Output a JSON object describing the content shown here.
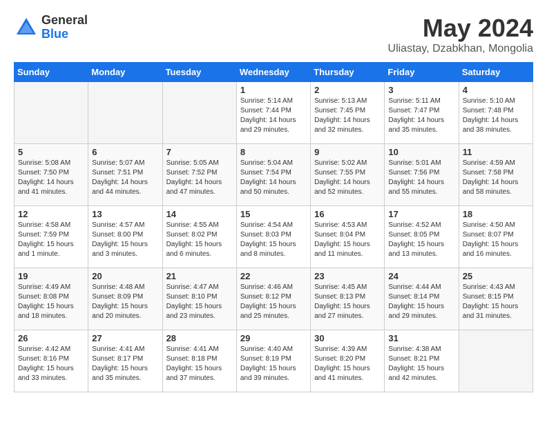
{
  "header": {
    "logo_line1": "General",
    "logo_line2": "Blue",
    "title": "May 2024",
    "subtitle": "Uliastay, Dzabkhan, Mongolia"
  },
  "weekdays": [
    "Sunday",
    "Monday",
    "Tuesday",
    "Wednesday",
    "Thursday",
    "Friday",
    "Saturday"
  ],
  "weeks": [
    [
      {
        "day": "",
        "empty": true
      },
      {
        "day": "",
        "empty": true
      },
      {
        "day": "",
        "empty": true
      },
      {
        "day": "1",
        "sunrise": "Sunrise: 5:14 AM",
        "sunset": "Sunset: 7:44 PM",
        "daylight": "Daylight: 14 hours and 29 minutes."
      },
      {
        "day": "2",
        "sunrise": "Sunrise: 5:13 AM",
        "sunset": "Sunset: 7:45 PM",
        "daylight": "Daylight: 14 hours and 32 minutes."
      },
      {
        "day": "3",
        "sunrise": "Sunrise: 5:11 AM",
        "sunset": "Sunset: 7:47 PM",
        "daylight": "Daylight: 14 hours and 35 minutes."
      },
      {
        "day": "4",
        "sunrise": "Sunrise: 5:10 AM",
        "sunset": "Sunset: 7:48 PM",
        "daylight": "Daylight: 14 hours and 38 minutes."
      }
    ],
    [
      {
        "day": "5",
        "sunrise": "Sunrise: 5:08 AM",
        "sunset": "Sunset: 7:50 PM",
        "daylight": "Daylight: 14 hours and 41 minutes."
      },
      {
        "day": "6",
        "sunrise": "Sunrise: 5:07 AM",
        "sunset": "Sunset: 7:51 PM",
        "daylight": "Daylight: 14 hours and 44 minutes."
      },
      {
        "day": "7",
        "sunrise": "Sunrise: 5:05 AM",
        "sunset": "Sunset: 7:52 PM",
        "daylight": "Daylight: 14 hours and 47 minutes."
      },
      {
        "day": "8",
        "sunrise": "Sunrise: 5:04 AM",
        "sunset": "Sunset: 7:54 PM",
        "daylight": "Daylight: 14 hours and 50 minutes."
      },
      {
        "day": "9",
        "sunrise": "Sunrise: 5:02 AM",
        "sunset": "Sunset: 7:55 PM",
        "daylight": "Daylight: 14 hours and 52 minutes."
      },
      {
        "day": "10",
        "sunrise": "Sunrise: 5:01 AM",
        "sunset": "Sunset: 7:56 PM",
        "daylight": "Daylight: 14 hours and 55 minutes."
      },
      {
        "day": "11",
        "sunrise": "Sunrise: 4:59 AM",
        "sunset": "Sunset: 7:58 PM",
        "daylight": "Daylight: 14 hours and 58 minutes."
      }
    ],
    [
      {
        "day": "12",
        "sunrise": "Sunrise: 4:58 AM",
        "sunset": "Sunset: 7:59 PM",
        "daylight": "Daylight: 15 hours and 1 minute."
      },
      {
        "day": "13",
        "sunrise": "Sunrise: 4:57 AM",
        "sunset": "Sunset: 8:00 PM",
        "daylight": "Daylight: 15 hours and 3 minutes."
      },
      {
        "day": "14",
        "sunrise": "Sunrise: 4:55 AM",
        "sunset": "Sunset: 8:02 PM",
        "daylight": "Daylight: 15 hours and 6 minutes."
      },
      {
        "day": "15",
        "sunrise": "Sunrise: 4:54 AM",
        "sunset": "Sunset: 8:03 PM",
        "daylight": "Daylight: 15 hours and 8 minutes."
      },
      {
        "day": "16",
        "sunrise": "Sunrise: 4:53 AM",
        "sunset": "Sunset: 8:04 PM",
        "daylight": "Daylight: 15 hours and 11 minutes."
      },
      {
        "day": "17",
        "sunrise": "Sunrise: 4:52 AM",
        "sunset": "Sunset: 8:05 PM",
        "daylight": "Daylight: 15 hours and 13 minutes."
      },
      {
        "day": "18",
        "sunrise": "Sunrise: 4:50 AM",
        "sunset": "Sunset: 8:07 PM",
        "daylight": "Daylight: 15 hours and 16 minutes."
      }
    ],
    [
      {
        "day": "19",
        "sunrise": "Sunrise: 4:49 AM",
        "sunset": "Sunset: 8:08 PM",
        "daylight": "Daylight: 15 hours and 18 minutes."
      },
      {
        "day": "20",
        "sunrise": "Sunrise: 4:48 AM",
        "sunset": "Sunset: 8:09 PM",
        "daylight": "Daylight: 15 hours and 20 minutes."
      },
      {
        "day": "21",
        "sunrise": "Sunrise: 4:47 AM",
        "sunset": "Sunset: 8:10 PM",
        "daylight": "Daylight: 15 hours and 23 minutes."
      },
      {
        "day": "22",
        "sunrise": "Sunrise: 4:46 AM",
        "sunset": "Sunset: 8:12 PM",
        "daylight": "Daylight: 15 hours and 25 minutes."
      },
      {
        "day": "23",
        "sunrise": "Sunrise: 4:45 AM",
        "sunset": "Sunset: 8:13 PM",
        "daylight": "Daylight: 15 hours and 27 minutes."
      },
      {
        "day": "24",
        "sunrise": "Sunrise: 4:44 AM",
        "sunset": "Sunset: 8:14 PM",
        "daylight": "Daylight: 15 hours and 29 minutes."
      },
      {
        "day": "25",
        "sunrise": "Sunrise: 4:43 AM",
        "sunset": "Sunset: 8:15 PM",
        "daylight": "Daylight: 15 hours and 31 minutes."
      }
    ],
    [
      {
        "day": "26",
        "sunrise": "Sunrise: 4:42 AM",
        "sunset": "Sunset: 8:16 PM",
        "daylight": "Daylight: 15 hours and 33 minutes."
      },
      {
        "day": "27",
        "sunrise": "Sunrise: 4:41 AM",
        "sunset": "Sunset: 8:17 PM",
        "daylight": "Daylight: 15 hours and 35 minutes."
      },
      {
        "day": "28",
        "sunrise": "Sunrise: 4:41 AM",
        "sunset": "Sunset: 8:18 PM",
        "daylight": "Daylight: 15 hours and 37 minutes."
      },
      {
        "day": "29",
        "sunrise": "Sunrise: 4:40 AM",
        "sunset": "Sunset: 8:19 PM",
        "daylight": "Daylight: 15 hours and 39 minutes."
      },
      {
        "day": "30",
        "sunrise": "Sunrise: 4:39 AM",
        "sunset": "Sunset: 8:20 PM",
        "daylight": "Daylight: 15 hours and 41 minutes."
      },
      {
        "day": "31",
        "sunrise": "Sunrise: 4:38 AM",
        "sunset": "Sunset: 8:21 PM",
        "daylight": "Daylight: 15 hours and 42 minutes."
      },
      {
        "day": "",
        "empty": true
      }
    ]
  ]
}
